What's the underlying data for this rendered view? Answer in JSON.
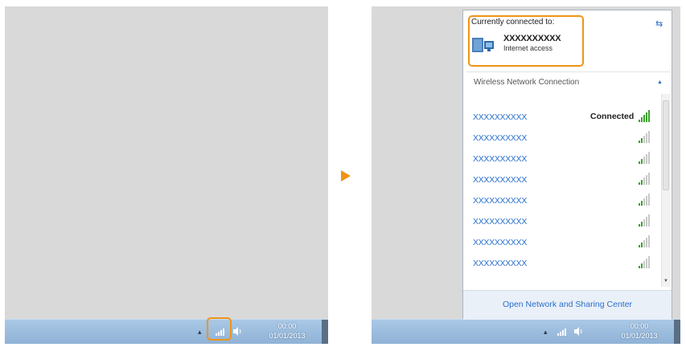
{
  "left_panel": {
    "taskbar": {
      "clock_time": "00:00",
      "clock_date": "01/01/2013",
      "tray_arrow": "▴",
      "network_icon": "network-signal-icon",
      "volume_icon": "speaker-icon"
    }
  },
  "arrow_icon": "play-arrow-icon",
  "right_panel": {
    "taskbar": {
      "clock_time": "00:00",
      "clock_date": "01/01/2013",
      "tray_arrow": "▴"
    },
    "popup": {
      "connected_heading": "Currently connected to:",
      "connected_network_name": "XXXXXXXXXX",
      "connected_network_status": "Internet access",
      "refresh_icon": "⇆",
      "section_title": "Wireless Network Connection",
      "collapse_icon": "▲",
      "networks": [
        {
          "name": "XXXXXXXXXX",
          "status": "Connected",
          "signal": "strong"
        },
        {
          "name": "XXXXXXXXXX",
          "status": "",
          "signal": "weak"
        },
        {
          "name": "XXXXXXXXXX",
          "status": "",
          "signal": "weak"
        },
        {
          "name": "XXXXXXXXXX",
          "status": "",
          "signal": "weak"
        },
        {
          "name": "XXXXXXXXXX",
          "status": "",
          "signal": "weak"
        },
        {
          "name": "XXXXXXXXXX",
          "status": "",
          "signal": "weak"
        },
        {
          "name": "XXXXXXXXXX",
          "status": "",
          "signal": "weak"
        },
        {
          "name": "XXXXXXXXXX",
          "status": "",
          "signal": "weak"
        }
      ],
      "scroll_down_icon": "▼",
      "footer_link": "Open Network and Sharing Center"
    }
  },
  "colors": {
    "highlight": "#ef9417",
    "link": "#2a6fcb",
    "signal_on": "#3ca12f",
    "signal_off": "#c8c8c8"
  }
}
